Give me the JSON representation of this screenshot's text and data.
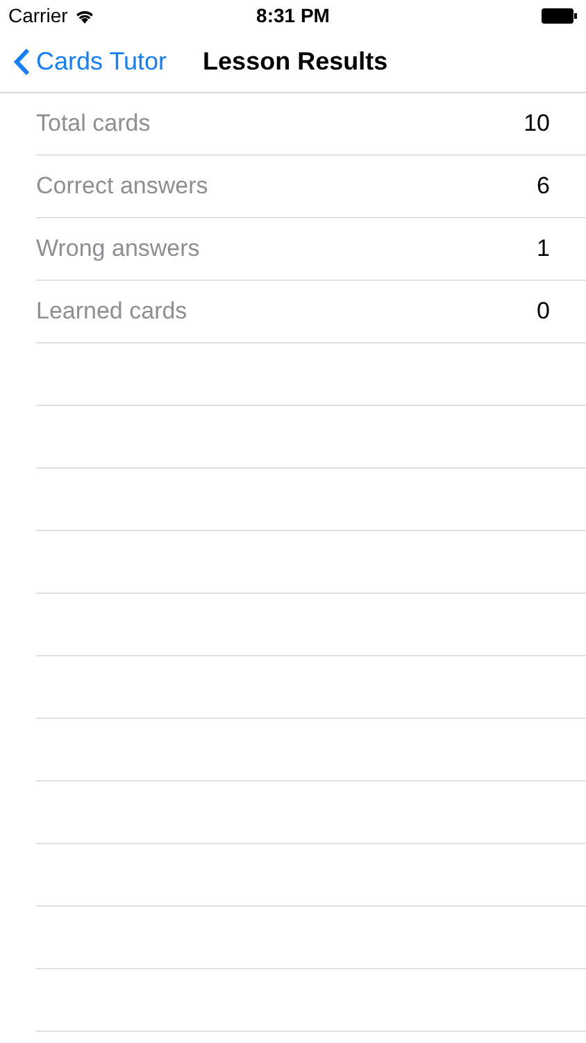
{
  "status_bar": {
    "carrier": "Carrier",
    "time": "8:31 PM"
  },
  "nav_bar": {
    "back": "Cards Tutor",
    "title": "Lesson Results"
  },
  "rows": [
    {
      "label": "Total cards",
      "value": "10"
    },
    {
      "label": "Correct answers",
      "value": "6"
    },
    {
      "label": "Wrong answers",
      "value": "1"
    },
    {
      "label": "Learned cards",
      "value": "0"
    }
  ]
}
